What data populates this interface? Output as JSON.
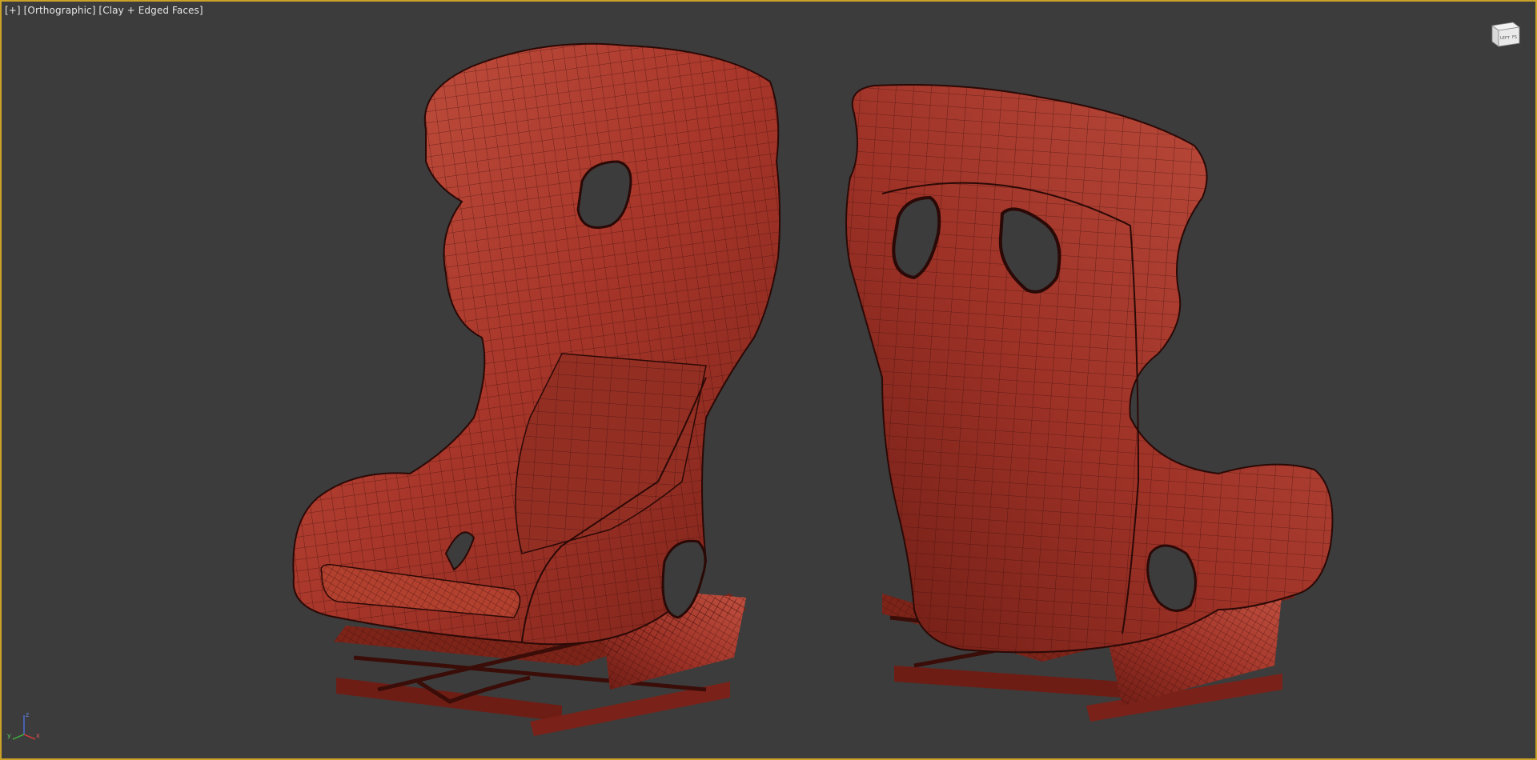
{
  "viewport": {
    "label_plus": "[+]",
    "label_view": "[Orthographic]",
    "label_shading": "[Clay + Edged Faces]",
    "active_border_color": "#c9a227",
    "background_color": "#3c3c3c"
  },
  "viewcube": {
    "face_left": "LEFT",
    "face_front": "FS"
  },
  "triad": {
    "axis_z": "z",
    "axis_y": "y",
    "axis_x": "x"
  },
  "scene": {
    "clay_color": "#a8362a",
    "wire_color": "#3a0d08",
    "objects": [
      "racing-seat-front",
      "racing-seat-back"
    ]
  }
}
